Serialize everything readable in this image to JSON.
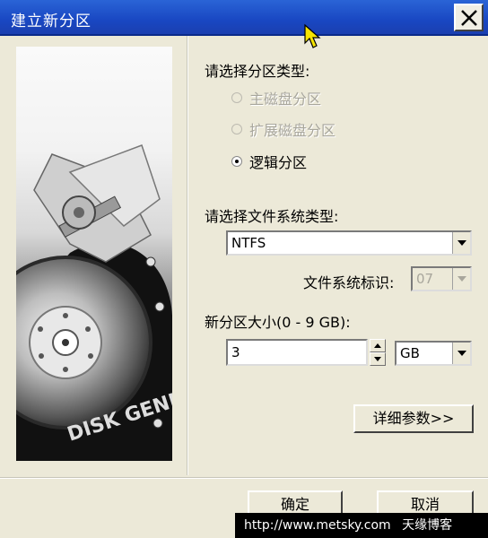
{
  "window": {
    "title": "建立新分区",
    "close_glyph": "✕"
  },
  "left_panel": {
    "logo_text": "DISK GENIUS"
  },
  "partition_type": {
    "heading": "请选择分区类型:",
    "options": [
      {
        "label": "主磁盘分区",
        "enabled": false,
        "checked": false
      },
      {
        "label": "扩展磁盘分区",
        "enabled": false,
        "checked": false
      },
      {
        "label": "逻辑分区",
        "enabled": true,
        "checked": true
      }
    ]
  },
  "filesystem": {
    "heading": "请选择文件系统类型:",
    "selected": "NTFS",
    "id_label": "文件系统标识:",
    "id_value": "07"
  },
  "size": {
    "heading": "新分区大小(0 - 9 GB):",
    "value": "3",
    "unit": "GB"
  },
  "buttons": {
    "details": "详细参数>>",
    "ok": "确定",
    "cancel": "取消"
  },
  "watermark": {
    "url": "http://www.metsky.com",
    "site": "天缘博客"
  }
}
